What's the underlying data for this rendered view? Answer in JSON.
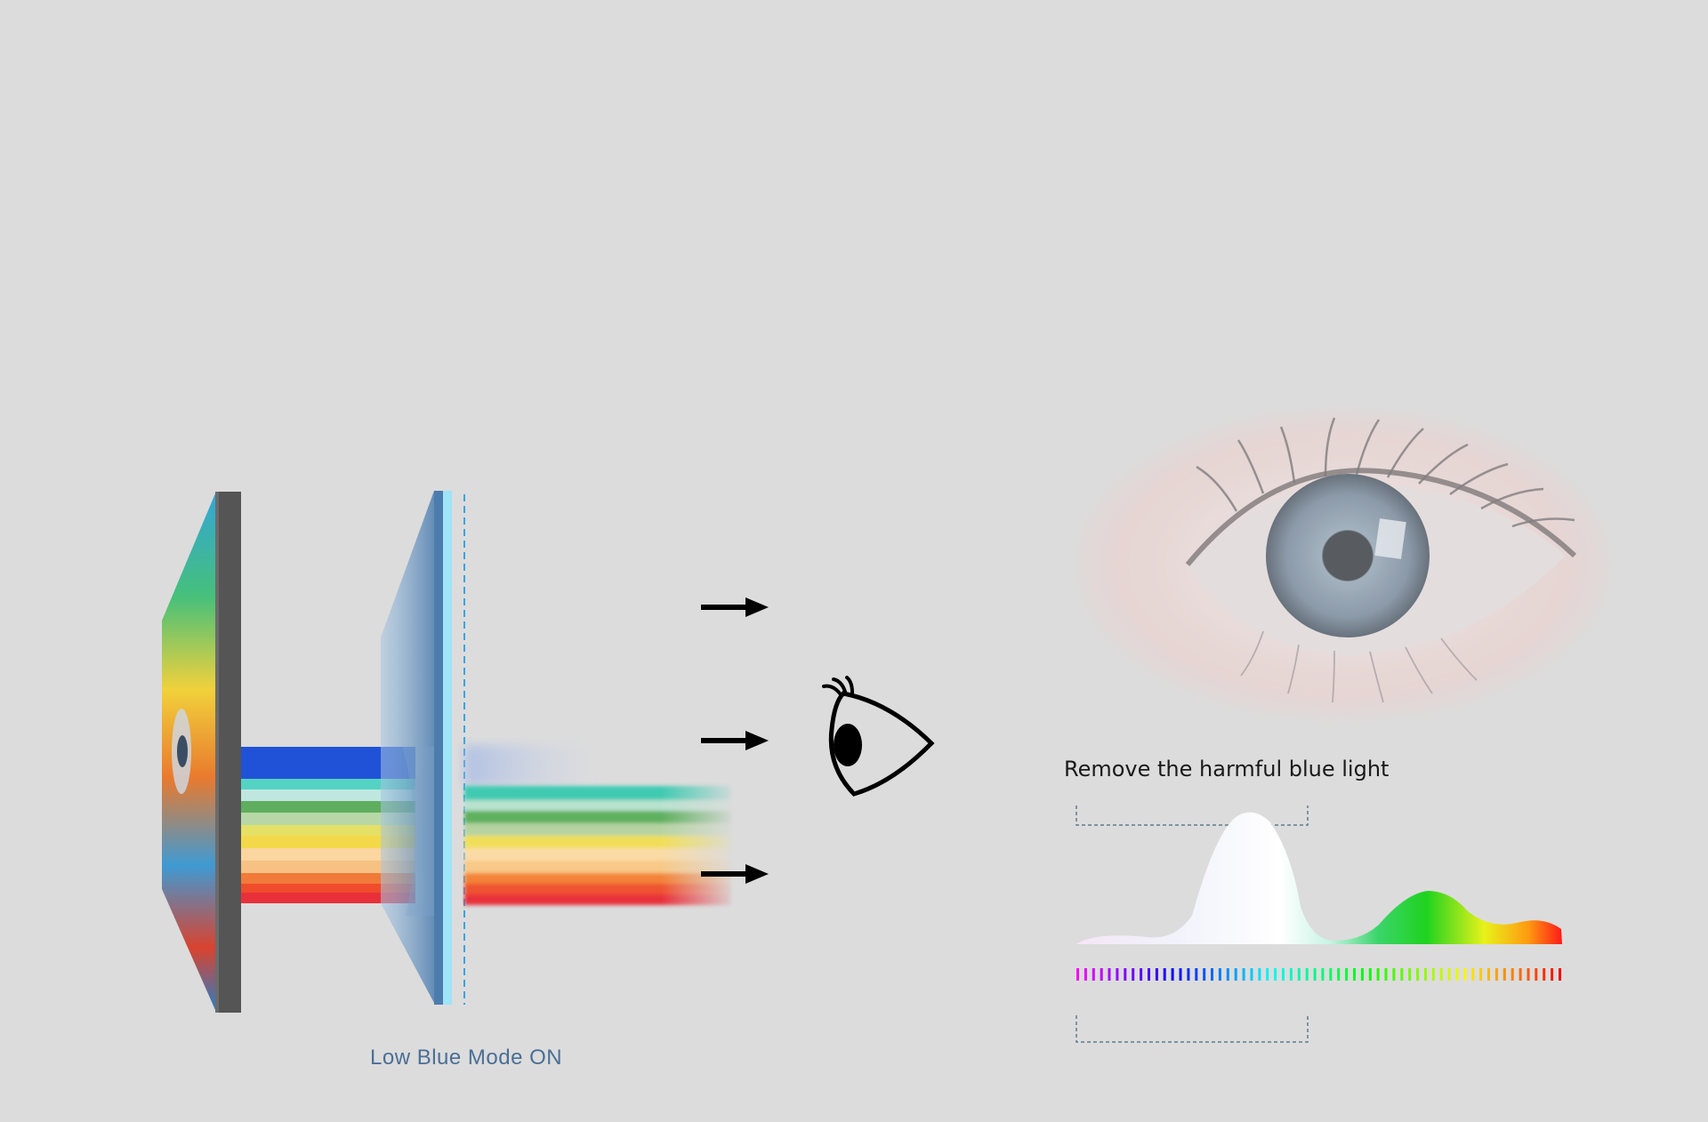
{
  "mode_label": "Low Blue Mode ON",
  "caption": "Remove the harmful blue light",
  "colors": {
    "background": "#dcdcdc",
    "label_blue": "#4a6f96",
    "filter_cyan": "#3ec6ee",
    "panel_gray": "#555555"
  },
  "icons": [
    "arrow-right-icon",
    "eye-icon"
  ]
}
